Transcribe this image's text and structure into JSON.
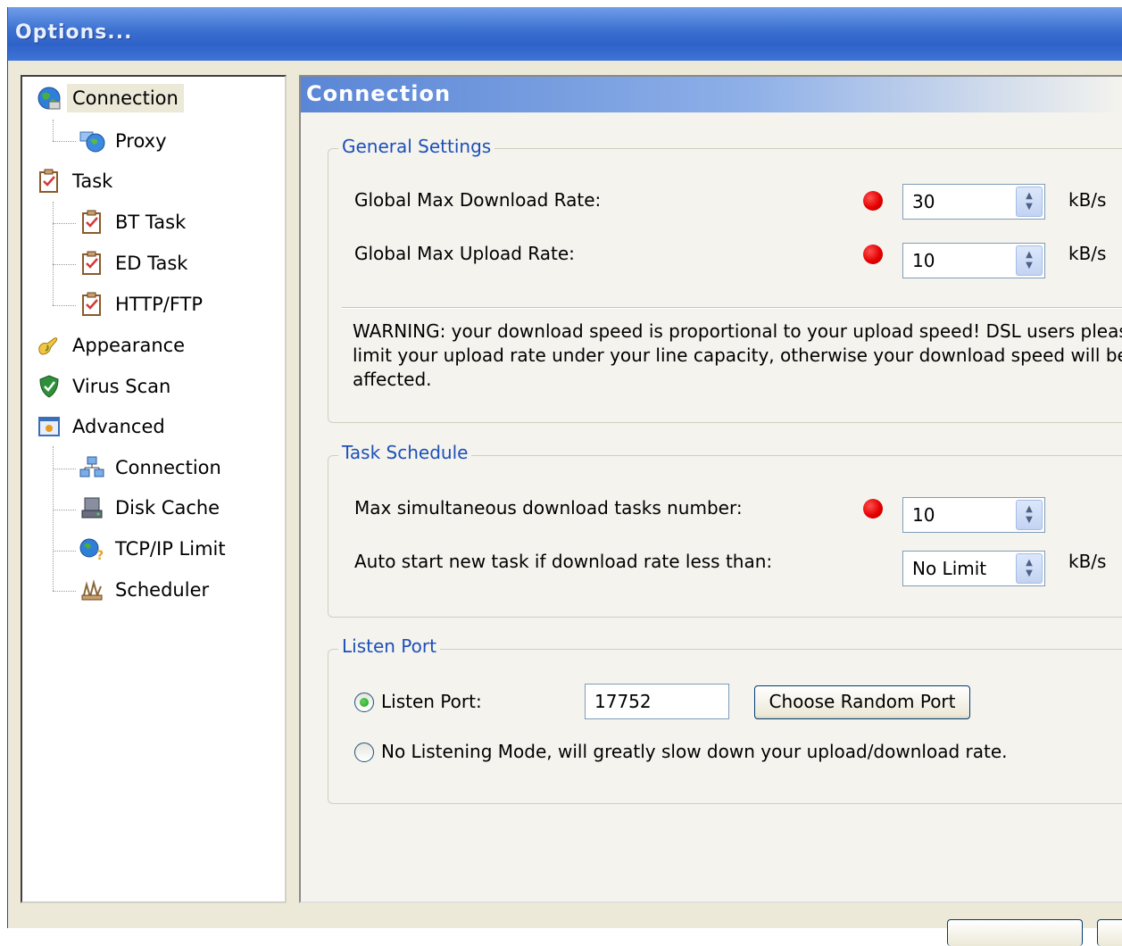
{
  "window": {
    "title": "Options..."
  },
  "tree": {
    "items": [
      {
        "label": "Connection",
        "icon": "globe-icon"
      },
      {
        "label": "Proxy",
        "icon": "network-globe-icon"
      },
      {
        "label": "Task",
        "icon": "clipboard-icon"
      },
      {
        "label": "BT Task",
        "icon": "clipboard-icon"
      },
      {
        "label": "ED Task",
        "icon": "clipboard-icon"
      },
      {
        "label": "HTTP/FTP",
        "icon": "clipboard-icon"
      },
      {
        "label": "Appearance",
        "icon": "paint-hand-icon"
      },
      {
        "label": "Virus Scan",
        "icon": "shield-icon"
      },
      {
        "label": "Advanced",
        "icon": "settings-box-icon"
      },
      {
        "label": "Connection",
        "icon": "network-icon"
      },
      {
        "label": "Disk Cache",
        "icon": "disk-icon"
      },
      {
        "label": "TCP/IP Limit",
        "icon": "globe-question-icon"
      },
      {
        "label": "Scheduler",
        "icon": "scheduler-icon"
      }
    ]
  },
  "panel": {
    "title": "Connection",
    "general": {
      "legend": "General Settings",
      "download_label": "Global Max Download Rate:",
      "download_value": "30",
      "download_unit": "kB/s",
      "upload_label": "Global Max Upload Rate:",
      "upload_value": "10",
      "upload_unit": "kB/s",
      "warning_line1": "WARNING: your download speed is proportional to your upload speed! DSL users pleas",
      "warning_line2": "limit your upload rate under your line capacity, otherwise your download speed will be",
      "warning_line3": "affected."
    },
    "schedule": {
      "legend": "Task Schedule",
      "max_tasks_label": "Max simultaneous download tasks number:",
      "max_tasks_value": "10",
      "auto_start_label": "Auto start new task if download rate less than:",
      "auto_start_value": "No Limit",
      "auto_start_unit": "kB/s"
    },
    "listen": {
      "legend": "Listen Port",
      "listen_port_label": "Listen Port:",
      "listen_port_value": "17752",
      "random_port_button": "Choose Random Port",
      "no_listen_label": "No Listening Mode, will greatly slow down your upload/download rate.",
      "selected": "listen_port"
    }
  },
  "colors": {
    "title_bar": "#3a6fd0",
    "legend_text": "#1c50b8",
    "indicator": "#e40000"
  }
}
